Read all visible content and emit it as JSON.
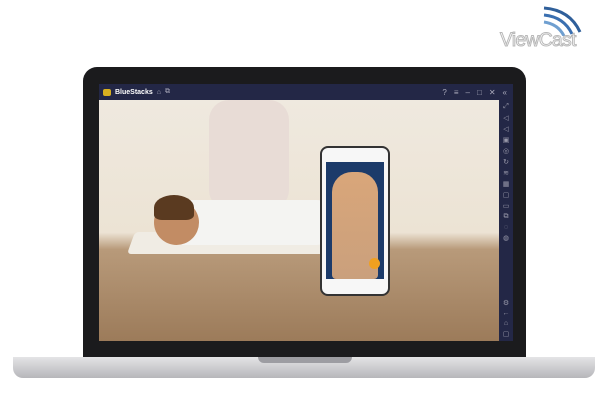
{
  "brand": {
    "logo_text": "ViewCast",
    "accent": "#3a6fb0"
  },
  "window": {
    "app_name": "BlueStacks",
    "titlebar_color": "#232746"
  },
  "titlebar_icons": [
    "home-icon",
    "multi-instance-icon",
    "help-icon",
    "menu-icon",
    "minimize-icon",
    "maximize-icon",
    "close-icon",
    "collapse-icon"
  ],
  "sidebar_icons": [
    "fullscreen-icon",
    "volume-up-icon",
    "volume-down-icon",
    "screen-record-icon",
    "screenshot-icon",
    "rotate-icon",
    "shake-icon",
    "keyboard-icon",
    "media-icon",
    "folder-icon",
    "copy-icon",
    "eco-icon",
    "macro-icon",
    "settings-icon",
    "back-icon",
    "home-icon",
    "recents-icon"
  ]
}
